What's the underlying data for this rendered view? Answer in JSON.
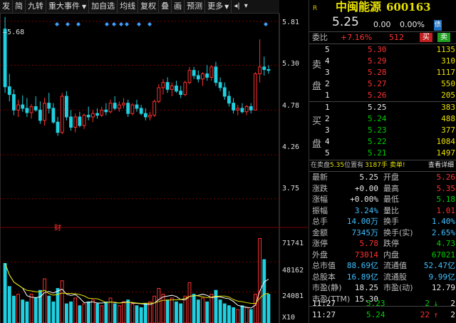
{
  "toolbar": {
    "items": [
      "发",
      "简",
      "九转",
      "重大事件",
      "加自选",
      "均线",
      "复权",
      "叠",
      "画",
      "预测",
      "更多"
    ]
  },
  "chart": {
    "price_labels": [
      "5.81",
      "5.30",
      "4.78",
      "4.26",
      "3.75"
    ],
    "prev_label": "5.68",
    "vol_labels": [
      "71741",
      "48162",
      "24081"
    ],
    "vol_unit": "X10",
    "finance_marker": "财"
  },
  "chart_data": {
    "type": "candlestick",
    "price_range": [
      3.5,
      5.9
    ],
    "candles": [
      [
        5.72,
        5.86,
        4.98,
        5.05
      ],
      [
        5.05,
        5.2,
        4.88,
        4.96
      ],
      [
        4.96,
        5.02,
        4.72,
        4.78
      ],
      [
        4.78,
        4.9,
        4.7,
        4.84
      ],
      [
        4.84,
        4.95,
        4.76,
        4.8
      ],
      [
        4.8,
        4.92,
        4.7,
        4.75
      ],
      [
        4.75,
        4.85,
        4.68,
        4.82
      ],
      [
        4.82,
        4.94,
        4.76,
        4.78
      ],
      [
        4.78,
        4.88,
        4.62,
        4.66
      ],
      [
        4.66,
        4.92,
        4.6,
        4.86
      ],
      [
        4.86,
        4.98,
        4.74,
        4.8
      ],
      [
        4.8,
        4.86,
        4.62,
        4.64
      ],
      [
        4.64,
        4.7,
        4.48,
        4.52
      ],
      [
        4.52,
        4.98,
        4.5,
        4.94
      ],
      [
        4.94,
        5.0,
        4.66,
        4.7
      ],
      [
        4.7,
        4.78,
        4.54,
        4.58
      ],
      [
        4.58,
        4.74,
        4.52,
        4.7
      ],
      [
        4.7,
        4.76,
        4.58,
        4.6
      ],
      [
        4.6,
        4.74,
        4.56,
        4.72
      ],
      [
        4.72,
        4.82,
        4.66,
        4.7
      ],
      [
        4.7,
        4.78,
        4.64,
        4.74
      ],
      [
        4.74,
        4.8,
        4.68,
        4.72
      ],
      [
        4.72,
        4.82,
        4.7,
        4.78
      ],
      [
        4.78,
        4.86,
        4.72,
        4.76
      ],
      [
        4.76,
        4.9,
        4.74,
        4.86
      ],
      [
        4.86,
        4.94,
        4.78,
        4.8
      ],
      [
        4.8,
        4.88,
        4.76,
        4.84
      ],
      [
        4.84,
        4.92,
        4.8,
        4.86
      ],
      [
        4.86,
        4.9,
        4.7,
        4.74
      ],
      [
        4.74,
        4.86,
        4.72,
        4.84
      ],
      [
        4.84,
        4.9,
        4.76,
        4.8
      ],
      [
        4.8,
        4.84,
        4.72,
        4.74
      ],
      [
        4.74,
        4.8,
        4.66,
        4.7
      ],
      [
        4.7,
        4.76,
        4.66,
        4.72
      ],
      [
        4.72,
        4.9,
        4.7,
        4.88
      ],
      [
        4.88,
        5.08,
        4.86,
        5.04
      ],
      [
        5.04,
        5.14,
        4.96,
        5.1
      ],
      [
        5.1,
        5.16,
        4.98,
        5.02
      ],
      [
        5.02,
        5.1,
        4.94,
        5.06
      ],
      [
        5.06,
        5.12,
        4.98,
        5.0
      ],
      [
        5.0,
        5.06,
        4.92,
        4.96
      ],
      [
        4.96,
        5.12,
        4.94,
        5.1
      ],
      [
        5.1,
        5.28,
        5.08,
        5.24
      ],
      [
        5.24,
        5.28,
        5.14,
        5.18
      ],
      [
        5.18,
        5.24,
        5.1,
        5.14
      ],
      [
        5.14,
        5.22,
        5.06,
        5.2
      ],
      [
        5.2,
        5.3,
        5.12,
        5.16
      ],
      [
        5.16,
        5.3,
        5.12,
        5.28
      ],
      [
        5.28,
        5.34,
        5.06,
        5.1
      ],
      [
        5.1,
        5.16,
        5.0,
        5.04
      ],
      [
        5.04,
        5.1,
        4.9,
        4.94
      ],
      [
        4.94,
        5.0,
        4.82,
        4.86
      ],
      [
        4.86,
        4.92,
        4.74,
        4.78
      ],
      [
        4.78,
        4.84,
        4.72,
        4.8
      ],
      [
        4.8,
        4.86,
        4.74,
        4.76
      ],
      [
        4.76,
        4.84,
        4.72,
        4.82
      ],
      [
        4.82,
        4.86,
        4.74,
        4.78
      ],
      [
        4.78,
        5.22,
        4.78,
        5.2
      ],
      [
        5.2,
        5.6,
        5.1,
        5.28
      ],
      [
        5.28,
        5.4,
        5.18,
        5.25
      ],
      [
        5.25,
        5.3,
        5.2,
        5.24
      ]
    ],
    "volumes": [
      62,
      38,
      28,
      30,
      24,
      22,
      30,
      26,
      34,
      46,
      28,
      22,
      36,
      44,
      20,
      22,
      26,
      18,
      20,
      22,
      24,
      20,
      18,
      22,
      26,
      20,
      18,
      22,
      24,
      20,
      18,
      16,
      20,
      22,
      28,
      36,
      30,
      24,
      26,
      22,
      20,
      28,
      42,
      30,
      24,
      26,
      22,
      30,
      34,
      24,
      20,
      18,
      16,
      14,
      18,
      16,
      14,
      30,
      88,
      66,
      30
    ],
    "vol_max": 95
  },
  "panel": {
    "logo": "R",
    "stock_name": "中闽能源",
    "stock_code": "600163",
    "price": "5.25",
    "change": "0.00",
    "change_pct": "0.00%",
    "tag": "债",
    "weibi_label": "委比",
    "weibi_pct": "+7.16%",
    "weibi_diff": "512",
    "sell_btn": "买",
    "buy_btn": "卖",
    "sell_side_label": [
      "卖",
      "盘"
    ],
    "buy_side_label": [
      "买",
      "盘"
    ],
    "asks": [
      {
        "level": "5",
        "price": "5.30",
        "vol": "1135"
      },
      {
        "level": "4",
        "price": "5.29",
        "vol": "310"
      },
      {
        "level": "3",
        "price": "5.28",
        "vol": "1117"
      },
      {
        "level": "2",
        "price": "5.27",
        "vol": "550"
      },
      {
        "level": "1",
        "price": "5.26",
        "vol": "205"
      }
    ],
    "bids": [
      {
        "level": "1",
        "price": "5.25",
        "vol": "383"
      },
      {
        "level": "2",
        "price": "5.24",
        "vol": "488"
      },
      {
        "level": "3",
        "price": "5.23",
        "vol": "377"
      },
      {
        "level": "4",
        "price": "5.22",
        "vol": "1084"
      },
      {
        "level": "5",
        "price": "5.21",
        "vol": "1497"
      }
    ],
    "notice": {
      "pre": "在卖盘",
      "price": "5.35",
      "mid": "位置有",
      "qty": "3187手",
      "post": "卖单!",
      "link": "查看详细"
    },
    "stats": [
      {
        "l1": "最新",
        "v1": "5.25",
        "c1": "white",
        "l2": "开盘",
        "v2": "5.26",
        "c2": "red"
      },
      {
        "l1": "涨跌",
        "v1": "+0.00",
        "c1": "white",
        "l2": "最高",
        "v2": "5.35",
        "c2": "red"
      },
      {
        "l1": "涨幅",
        "v1": "+0.00%",
        "c1": "white",
        "l2": "最低",
        "v2": "5.18",
        "c2": "green"
      },
      {
        "l1": "振幅",
        "v1": "3.24%",
        "c1": "cyan",
        "l2": "量比",
        "v2": "1.01",
        "c2": "red"
      },
      {
        "l1": "总手",
        "v1": "14.00万",
        "c1": "cyan",
        "l2": "换手",
        "v2": "1.40%",
        "c2": "cyan"
      },
      {
        "l1": "金额",
        "v1": "7345万",
        "c1": "cyan",
        "l2": "换手(实)",
        "v2": "2.65%",
        "c2": "cyan"
      },
      {
        "l1": "涨停",
        "v1": "5.78",
        "c1": "red",
        "l2": "跌停",
        "v2": "4.73",
        "c2": "green"
      },
      {
        "l1": "外盘",
        "v1": "73014",
        "c1": "red",
        "l2": "内盘",
        "v2": "67021",
        "c2": "green"
      },
      {
        "l1": "总市值",
        "v1": "88.69亿",
        "c1": "cyan",
        "l2": "流通值",
        "v2": "52.47亿",
        "c2": "cyan"
      },
      {
        "l1": "总股本",
        "v1": "16.89亿",
        "c1": "cyan",
        "l2": "流通股",
        "v2": "9.99亿",
        "c2": "cyan"
      },
      {
        "l1": "市盈(静)",
        "v1": "18.25",
        "c1": "white",
        "l2": "市盈(动)",
        "v2": "12.79",
        "c2": "white"
      },
      {
        "l1": "市盈(TTM)",
        "v1": "15.30",
        "c1": "white",
        "l2": "",
        "v2": "",
        "c2": "white"
      }
    ],
    "ticks": [
      {
        "time": "11:27",
        "price": "5.23",
        "vol": "2",
        "dir": "down",
        "n": "2"
      },
      {
        "time": "11:27",
        "price": "5.24",
        "vol": "22",
        "dir": "up",
        "n": "2"
      }
    ]
  }
}
